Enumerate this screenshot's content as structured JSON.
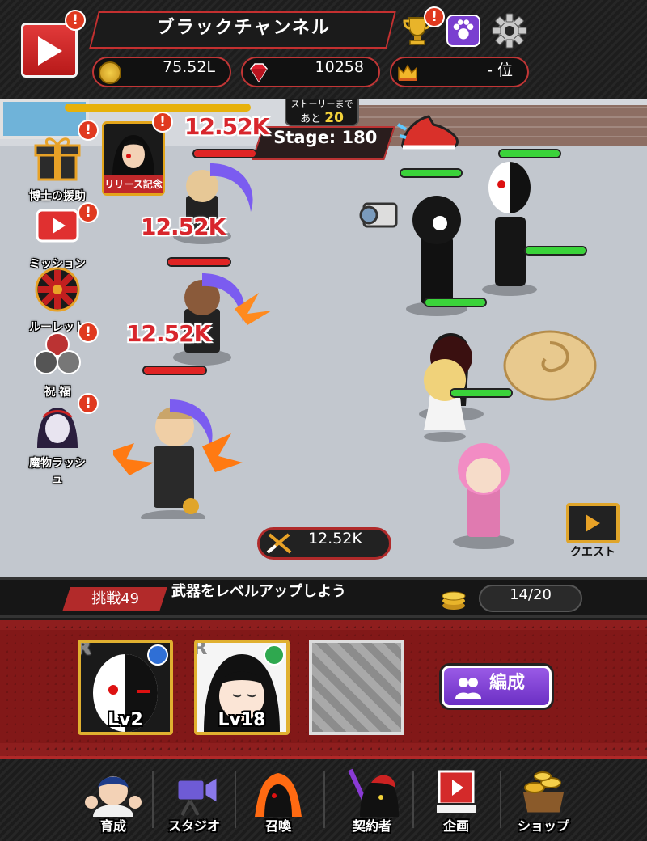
{
  "header": {
    "channel_name": "ブラックチャンネル",
    "coins": "75.52L",
    "gems": "10258",
    "rank": "- 位",
    "badge_mark": "!"
  },
  "battle": {
    "story_tip_line1": "ストーリーまで",
    "story_tip_prefix": "あと",
    "story_tip_count": "20",
    "stage_label": "Stage: 180",
    "damage_numbers": [
      "12.52K",
      "12.52K",
      "12.52K"
    ],
    "team_power": "12.52K",
    "side_buttons": [
      {
        "label": "博士の援助",
        "icon": "gift-box-icon"
      },
      {
        "label": "ミッション",
        "icon": "play-mission-icon"
      },
      {
        "label": "ルーレット",
        "icon": "roulette-icon"
      },
      {
        "label": "祝 福",
        "icon": "blessing-icon"
      },
      {
        "label": "魔物ラッシュ",
        "icon": "monster-rush-icon"
      }
    ],
    "release_label": "リリース記念",
    "quest_label": "クエスト"
  },
  "challenge": {
    "tag": "挑戦49",
    "text": "武器をレベルアップしよう",
    "progress": "14/20"
  },
  "team": {
    "cards": [
      {
        "rarity": "R",
        "level": "Lv2",
        "role_color": "#2f6fd6"
      },
      {
        "rarity": "R",
        "level": "Lv18",
        "role_color": "#2fa84f"
      }
    ],
    "formation_label": "編成"
  },
  "nav": [
    {
      "label": "育成",
      "icon": "training-icon"
    },
    {
      "label": "スタジオ",
      "icon": "studio-icon"
    },
    {
      "label": "召喚",
      "icon": "summon-icon"
    },
    {
      "label": "契約者",
      "icon": "contractor-icon"
    },
    {
      "label": "企画",
      "icon": "project-icon"
    },
    {
      "label": "ショップ",
      "icon": "shop-icon"
    }
  ],
  "colors": {
    "accent_red": "#c23636",
    "gold": "#e0b030",
    "purple": "#7a3fd0",
    "hp_green": "#3ad33a",
    "hp_red": "#e02424"
  }
}
